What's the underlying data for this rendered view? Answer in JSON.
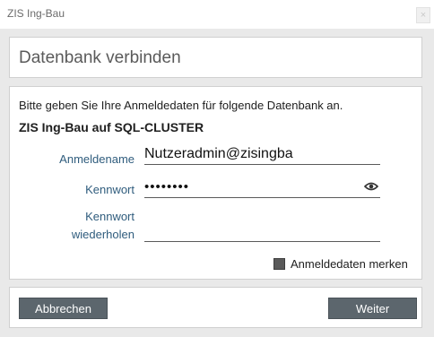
{
  "window": {
    "title": "ZIS Ing-Bau",
    "close_glyph": "×"
  },
  "header": {
    "heading": "Datenbank verbinden"
  },
  "main": {
    "instruction": "Bitte geben Sie Ihre Anmeldedaten für folgende Datenbank an.",
    "database_name": "ZIS Ing-Bau auf SQL-CLUSTER",
    "username": {
      "label": "Anmeldename",
      "value": "Nutzeradmin@zisingba"
    },
    "password": {
      "label": "Kennwort",
      "value": "••••••••"
    },
    "password_repeat": {
      "label_line1": "Kennwort",
      "label_line2": "wiederholen",
      "value": ""
    },
    "remember": {
      "label": "Anmeldedaten merken",
      "checked": true
    }
  },
  "footer": {
    "cancel_label": "Abbrechen",
    "next_label": "Weiter"
  },
  "colors": {
    "label": "#2f5c7d",
    "button": "#5c666d",
    "background": "#e9e9e9"
  }
}
